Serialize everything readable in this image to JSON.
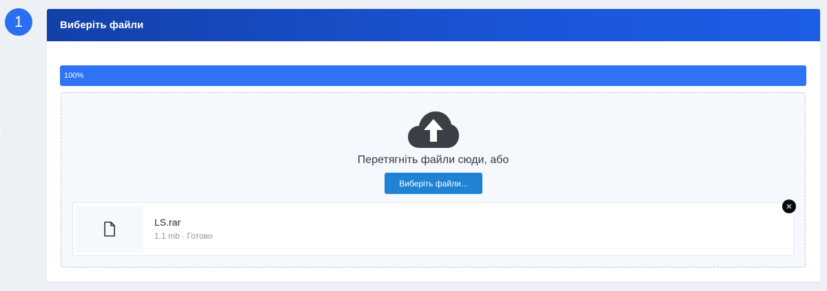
{
  "step": {
    "number": "1"
  },
  "panel": {
    "title": "Виберіть файли"
  },
  "progress": {
    "label": "100%",
    "value": 100
  },
  "dropzone": {
    "icon": "cloud-upload-icon",
    "prompt": "Перетягніть файли сюди, або",
    "browse_label": "Виберіть файли..."
  },
  "files": [
    {
      "name": "LS.rar",
      "meta": "1.1 mb · Готово",
      "icon": "file-icon",
      "remove_icon": "close-icon"
    }
  ],
  "colors": {
    "accent": "#2f74f5",
    "header_start": "#1340a8",
    "header_end": "#1d5ee6",
    "button": "#1f82d4",
    "badge": "#2b6ff0"
  }
}
